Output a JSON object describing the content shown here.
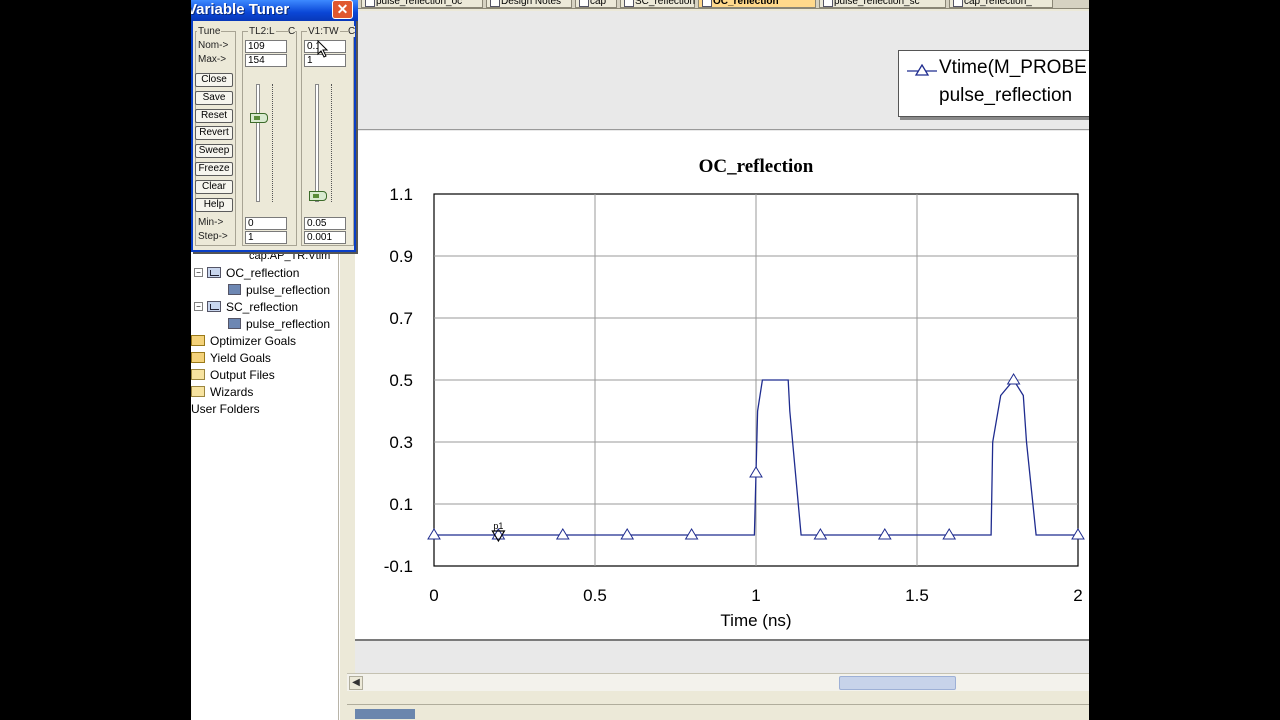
{
  "tuner": {
    "title": "Variable Tuner",
    "close_glyph": "✕",
    "tune_label": "Tune",
    "nom_label": "Nom->",
    "max_label": "Max->",
    "min_label": "Min->",
    "step_label": "Step->",
    "buttons": [
      "Close",
      "Save",
      "Reset",
      "Revert",
      "Sweep",
      "Freeze",
      "Clear",
      "Help"
    ],
    "var1": {
      "name": "TL2:L",
      "suffix": "C",
      "nom": "109",
      "max": "154",
      "min": "0",
      "step": "1",
      "position": 0.708
    },
    "var2": {
      "name": "V1:TW",
      "suffix": "C",
      "nom": "0.1",
      "max": "1",
      "min": "0.05",
      "step": "0.001",
      "position": 0.053
    }
  },
  "tree": {
    "partial_item": "cap:AP_TR:Vtim",
    "items": [
      {
        "label": "OC_reflection",
        "kind": "graph",
        "expander": "−"
      },
      {
        "label": "pulse_reflection",
        "kind": "measurement"
      },
      {
        "label": "SC_reflection",
        "kind": "graph",
        "expander": "−"
      },
      {
        "label": "pulse_reflection",
        "kind": "measurement"
      },
      {
        "label": "Optimizer Goals",
        "kind": "goal"
      },
      {
        "label": "Yield Goals",
        "kind": "goal"
      },
      {
        "label": "Output Files",
        "kind": "folder"
      },
      {
        "label": "Wizards",
        "kind": "folder"
      },
      {
        "label": "User Folders",
        "kind": "folder"
      }
    ]
  },
  "tabs": [
    {
      "label": "pulse_reflection_oc",
      "active": false
    },
    {
      "label": "Design Notes",
      "active": false
    },
    {
      "label": "cap",
      "active": false
    },
    {
      "label": "SC_reflection",
      "active": false
    },
    {
      "label": "OC_reflection",
      "active": true
    },
    {
      "label": "pulse_reflection_sc",
      "active": false
    },
    {
      "label": "cap_reflection_",
      "active": false
    }
  ],
  "legend": {
    "line1": "Vtime(M_PROBE",
    "line2": "pulse_reflection",
    "color": "#1f2c8f"
  },
  "chart_data": {
    "type": "line",
    "title": "OC_reflection",
    "xlabel": "Time (ns)",
    "ylabel": "",
    "xlim": [
      0,
      2
    ],
    "ylim": [
      -0.1,
      1.1
    ],
    "xticks": [
      0,
      0.5,
      1,
      1.5,
      2
    ],
    "yticks": [
      -0.1,
      0.1,
      0.3,
      0.5,
      0.7,
      0.9,
      1.1
    ],
    "grid": true,
    "series": [
      {
        "x": [
          0,
          0.995,
          1.005,
          1.02,
          1.1,
          1.105,
          1.14,
          1.6,
          1.73,
          1.735,
          1.76,
          1.8,
          1.83,
          1.84,
          1.87,
          2
        ],
        "y": [
          0,
          0,
          0.4,
          0.5,
          0.5,
          0.4,
          0,
          0,
          0,
          0.3,
          0.45,
          0.5,
          0.45,
          0.3,
          0,
          0
        ],
        "markers_x": [
          0,
          0.2,
          0.4,
          0.6,
          0.8,
          1.0,
          1.2,
          1.4,
          1.6,
          1.8,
          2.0
        ]
      }
    ],
    "marker_label": "p1",
    "color": "#1f2c8f"
  }
}
